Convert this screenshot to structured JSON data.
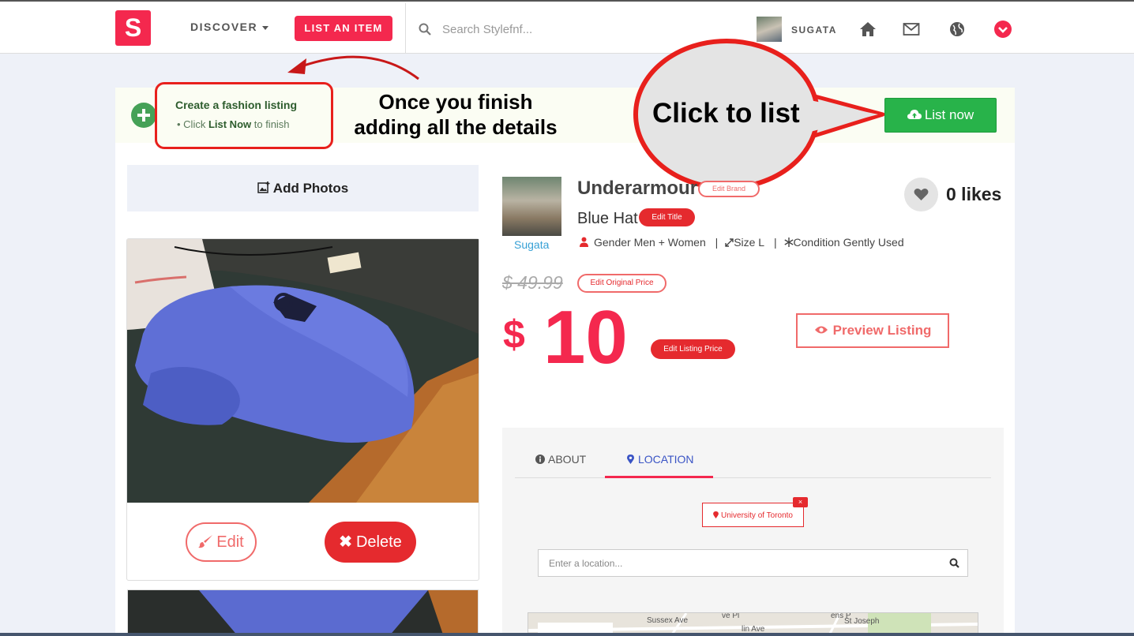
{
  "nav": {
    "logo_letter": "S",
    "discover_label": "DISCOVER",
    "list_item_label": "LIST AN ITEM",
    "search_placeholder": "Search Stylefnf...",
    "username": "SUGATA"
  },
  "banner": {
    "hint_title": "Create a fashion listing",
    "hint_sub_prefix": "Click ",
    "hint_sub_bold": "List Now",
    "hint_sub_suffix": " to finish",
    "list_now_label": "List now"
  },
  "annotations": {
    "finish_line1": "Once you finish",
    "finish_line2": "adding all the details",
    "callout": "Click to list"
  },
  "photos": {
    "add_photos_label": "Add Photos",
    "edit_label": "Edit",
    "delete_label": "Delete"
  },
  "listing": {
    "seller_name": "Sugata",
    "brand": "Underarmour",
    "edit_brand_label": "Edit Brand",
    "title": "Blue Hat",
    "edit_title_label": "Edit Title",
    "gender": "Gender Men + Women",
    "size": "Size L",
    "condition": "Condition Gently Used",
    "likes": "0 likes",
    "original_price": "$ 49.99",
    "edit_original_price_label": "Edit Original Price",
    "currency_symbol": "$",
    "price": "10",
    "edit_listing_price_label": "Edit Listing Price",
    "preview_label": "Preview Listing"
  },
  "tabs": {
    "about_label": "ABOUT",
    "location_label": "LOCATION",
    "active": "LOCATION"
  },
  "location": {
    "tag": "University of Toronto",
    "remove_symbol": "×",
    "input_placeholder": "Enter a location...",
    "map_labels": [
      "Sussex Ave",
      "lin Ave",
      "St Joseph",
      "ens P",
      "ve Pl"
    ]
  },
  "colors": {
    "brand_red": "#f4284e",
    "delete_red": "#e52a2e",
    "list_now_green": "#28b34a",
    "seller_link_blue": "#36a0d5",
    "annotation_red": "#e8201c"
  }
}
